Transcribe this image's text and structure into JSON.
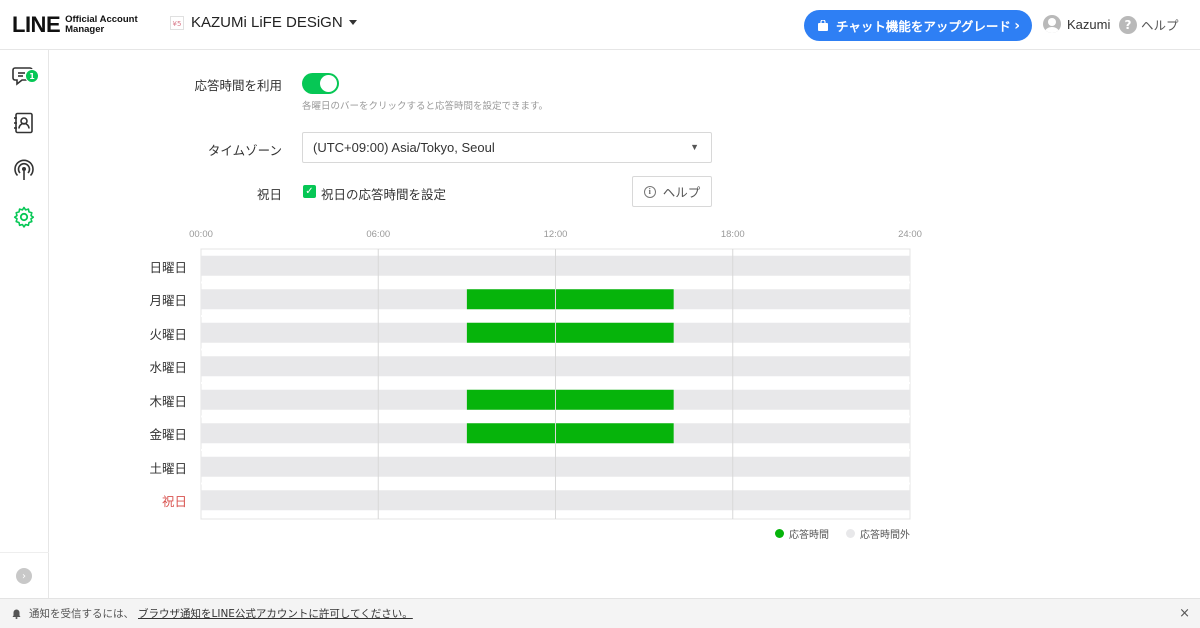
{
  "header": {
    "logo_main": "LINE",
    "logo_sub_line1": "Official Account",
    "logo_sub_line2": "Manager",
    "account_name": "KAZUMi LiFE DESiGN",
    "upgrade_label": "チャット機能をアップグレード",
    "user_name": "Kazumi",
    "help_label": "ヘルプ"
  },
  "sidebar": {
    "chat_badge": "1",
    "icons": [
      "chat-icon",
      "contacts-icon",
      "broadcast-icon",
      "settings-icon"
    ],
    "active_color": "#06c755"
  },
  "form": {
    "response_time_label": "応答時間を利用",
    "response_time_enabled": true,
    "hint": "各曜日のバーをクリックすると応答時間を設定できます。",
    "timezone_label": "タイムゾーン",
    "timezone_value": "(UTC+09:00) Asia/Tokyo, Seoul",
    "holiday_label": "祝日",
    "holiday_checkbox_label": "祝日の応答時間を設定",
    "holiday_checked": true,
    "help_button": "ヘルプ"
  },
  "chart_data": {
    "type": "bar",
    "orientation": "horizontal-timeline",
    "x_ticks": [
      "00:00",
      "06:00",
      "12:00",
      "18:00",
      "24:00"
    ],
    "xlim": [
      0,
      24
    ],
    "grid": true,
    "legend_placement": "bottom-right",
    "categories": [
      "日曜日",
      "月曜日",
      "火曜日",
      "水曜日",
      "木曜日",
      "金曜日",
      "土曜日",
      "祝日"
    ],
    "ranges": [
      null,
      [
        9,
        16
      ],
      [
        9,
        16
      ],
      null,
      [
        9,
        16
      ],
      [
        9,
        16
      ],
      null,
      null
    ],
    "legend": [
      {
        "label": "応答時間",
        "color": "#06b40b"
      },
      {
        "label": "応答時間外",
        "color": "#e8e8ea"
      }
    ],
    "holiday_label_color": "#d9534f"
  },
  "footer": {
    "notice_text": "通知を受信するには、",
    "notice_link": "ブラウザ通知をLINE公式アカウントに許可してください。",
    "close": "×"
  }
}
